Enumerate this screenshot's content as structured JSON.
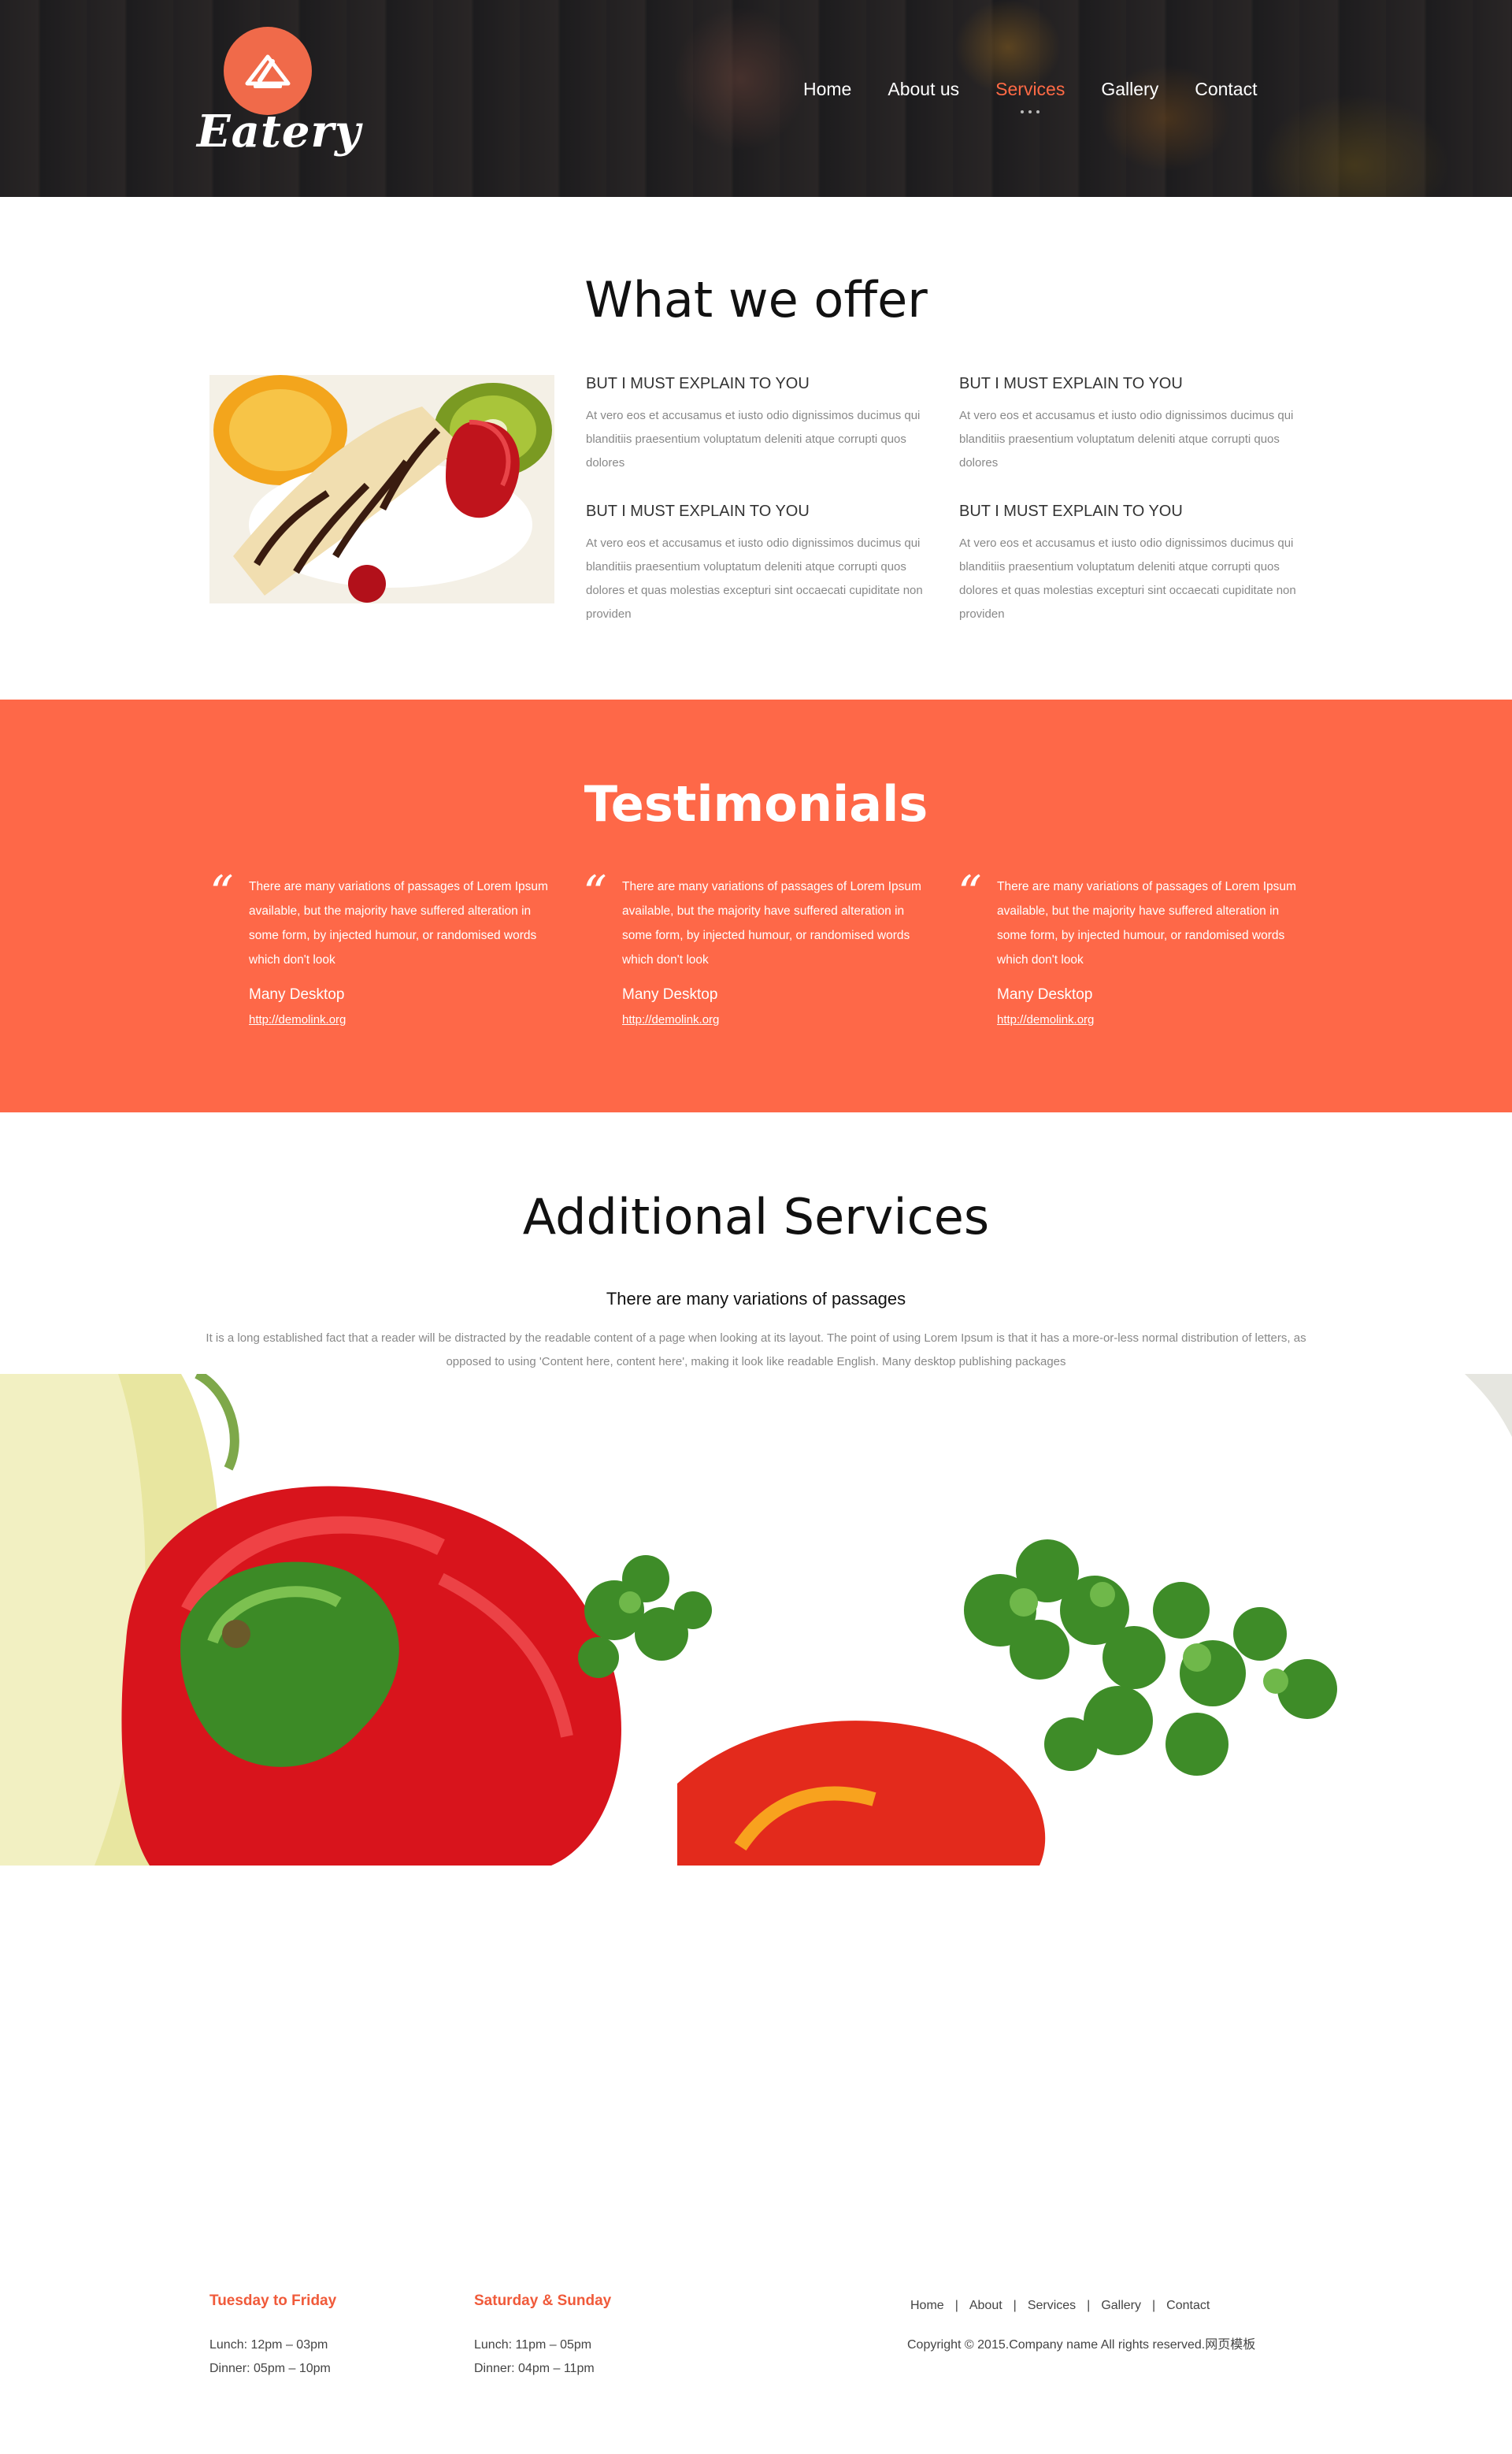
{
  "header": {
    "logo_text": "Eatery",
    "nav": [
      {
        "label": "Home",
        "active": false
      },
      {
        "label": "About us",
        "active": false
      },
      {
        "label": "Services",
        "active": true
      },
      {
        "label": "Gallery",
        "active": false
      },
      {
        "label": "Contact",
        "active": false
      }
    ]
  },
  "offer": {
    "title": "What we offer",
    "items": [
      {
        "heading": "BUT I MUST EXPLAIN TO YOU",
        "text": "At vero eos et accusamus et iusto odio dignissimos ducimus qui blanditiis praesentium voluptatum deleniti atque corrupti quos dolores"
      },
      {
        "heading": "BUT I MUST EXPLAIN TO YOU",
        "text": "At vero eos et accusamus et iusto odio dignissimos ducimus qui blanditiis praesentium voluptatum deleniti atque corrupti quos dolores"
      },
      {
        "heading": "BUT I MUST EXPLAIN TO YOU",
        "text": "At vero eos et accusamus et iusto odio dignissimos ducimus qui blanditiis praesentium voluptatum deleniti atque corrupti quos dolores et quas molestias excepturi sint occaecati cupiditate non providen"
      },
      {
        "heading": "BUT I MUST EXPLAIN TO YOU",
        "text": "At vero eos et accusamus et iusto odio dignissimos ducimus qui blanditiis praesentium voluptatum deleniti atque corrupti quos dolores et quas molestias excepturi sint occaecati cupiditate non providen"
      }
    ]
  },
  "testimonials": {
    "title": "Testimonials",
    "quote_mark": "“",
    "items": [
      {
        "text": "There are many variations of passages of Lorem Ipsum available, but the majority have suffered alteration in some form, by injected humour, or randomised words which don't look",
        "name": "Many Desktop",
        "link": "http://demolink.org"
      },
      {
        "text": "There are many variations of passages of Lorem Ipsum available, but the majority have suffered alteration in some form, by injected humour, or randomised words which don't look",
        "name": "Many Desktop",
        "link": "http://demolink.org"
      },
      {
        "text": "There are many variations of passages of Lorem Ipsum available, but the majority have suffered alteration in some form, by injected humour, or randomised words which don't look",
        "name": "Many Desktop",
        "link": "http://demolink.org"
      }
    ]
  },
  "additional": {
    "title": "Additional Services",
    "subtitle": "There are many variations of passages",
    "description": "It is a long established fact that a reader will be distracted by the readable content of a page when looking at its layout. The point of using Lorem Ipsum is that it has a more-or-less normal distribution of letters, as opposed to using 'Content here, content here', making it look like readable English. Many desktop publishing packages"
  },
  "footer": {
    "hours": [
      {
        "title": "Tuesday to Friday",
        "lunch": "Lunch: 12pm – 03pm",
        "dinner": "Dinner: 05pm – 10pm"
      },
      {
        "title": "Saturday & Sunday",
        "lunch": "Lunch: 11pm – 05pm",
        "dinner": "Dinner: 04pm – 11pm"
      }
    ],
    "nav": [
      "Home",
      "About",
      "Services",
      "Gallery",
      "Contact"
    ],
    "separator": "|",
    "copyright": "Copyright © 2015.Company name All rights reserved.网页模板"
  },
  "colors": {
    "accent": "#fe6848",
    "accent_text": "#f05a3a",
    "heading": "#111111",
    "body_text": "#888888"
  },
  "icons": {
    "logo": "chef-hat-knife-icon",
    "quote": "quote-icon",
    "active_nav": "dots-indicator-icon"
  }
}
